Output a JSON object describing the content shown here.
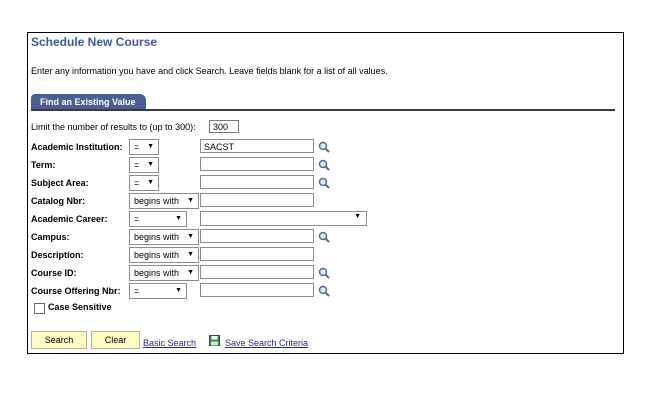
{
  "page": {
    "title": "Schedule New Course",
    "instructions": "Enter any information you have and click Search. Leave fields blank for a list of all values."
  },
  "tab": {
    "label": "Find an Existing Value"
  },
  "limit": {
    "label": "Limit the number of results to (up to 300):",
    "value": "300"
  },
  "fields": [
    {
      "label": "Academic Institution:",
      "operator": "=",
      "value": "SACST"
    },
    {
      "label": "Term:",
      "operator": "=",
      "value": ""
    },
    {
      "label": "Subject Area:",
      "operator": "=",
      "value": ""
    },
    {
      "label": "Catalog Nbr:",
      "operator": "begins with",
      "value": ""
    },
    {
      "label": "Academic Career:",
      "operator": "=",
      "value": ""
    },
    {
      "label": "Campus:",
      "operator": "begins with",
      "value": ""
    },
    {
      "label": "Description:",
      "operator": "begins with",
      "value": ""
    },
    {
      "label": "Course ID:",
      "operator": "begins with",
      "value": ""
    },
    {
      "label": "Course Offering Nbr:",
      "operator": "=",
      "value": ""
    }
  ],
  "case_sensitive": {
    "label": "Case Sensitive"
  },
  "buttons": {
    "search": "Search",
    "clear": "Clear"
  },
  "links": {
    "basic_search": "Basic Search",
    "save_criteria": "Save Search Criteria"
  },
  "icons": {
    "lookup": "magnifier-icon",
    "save": "floppy-disk-icon"
  },
  "colors": {
    "title": "#3a5a9b",
    "tab_bg": "#4a5e94",
    "button_bg": "#fefcc2",
    "link": "#2222aa"
  }
}
